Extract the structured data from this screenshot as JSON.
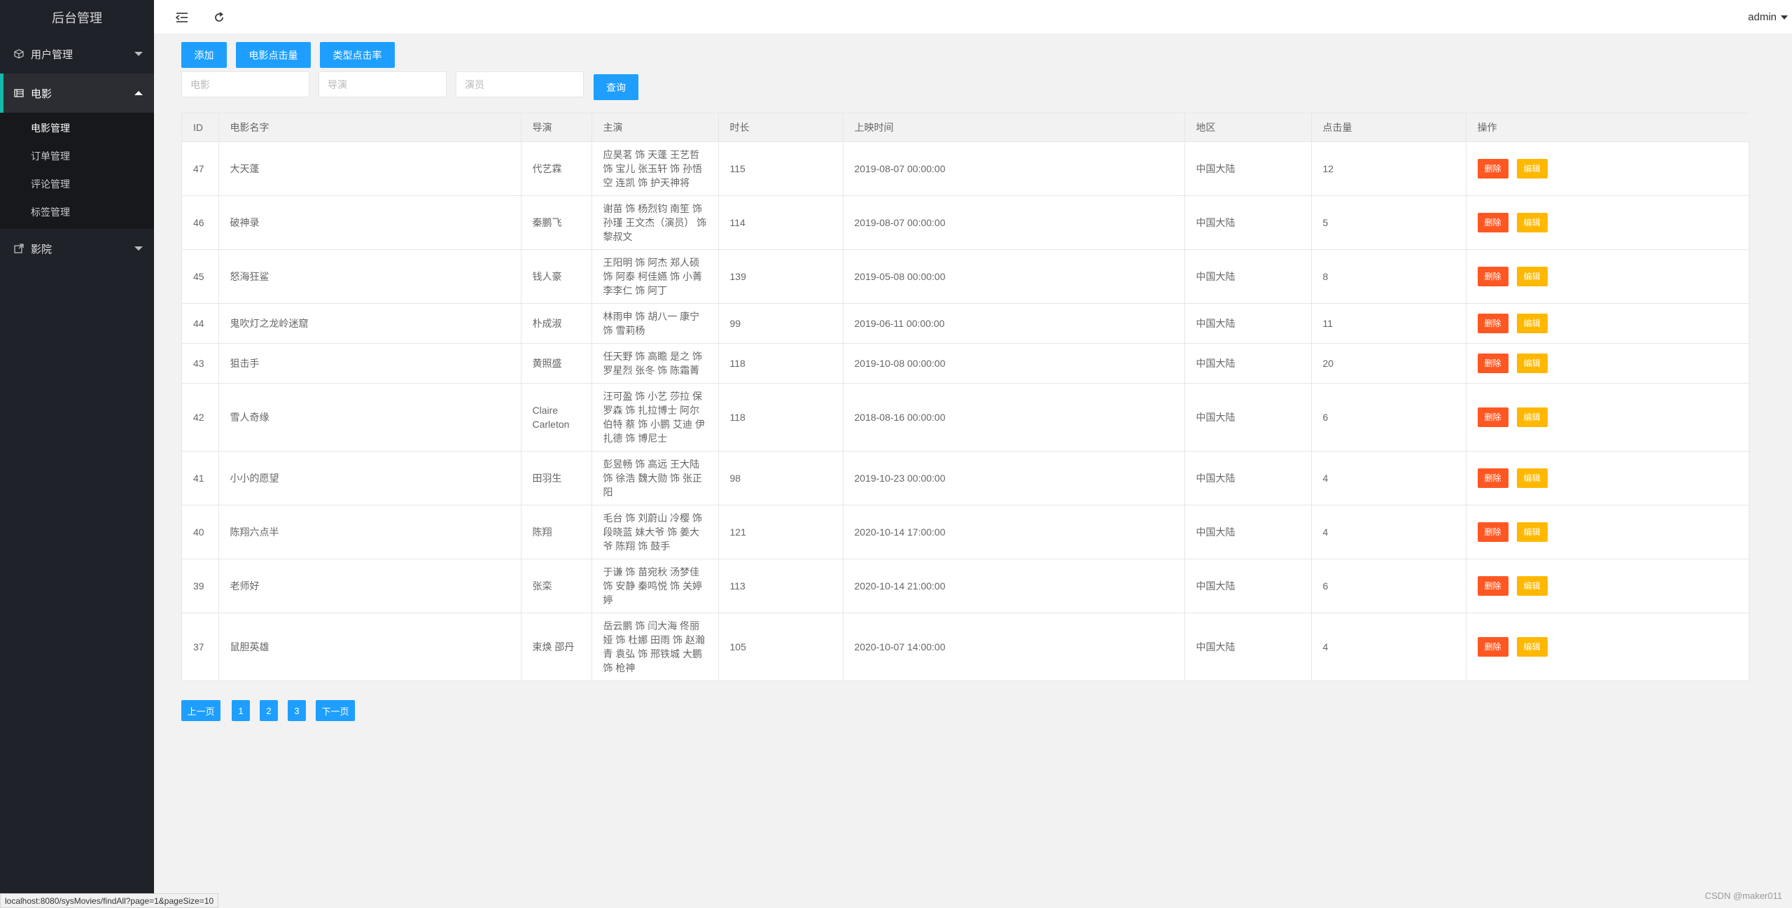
{
  "app": {
    "title": "后台管理"
  },
  "sidebar": {
    "items": [
      {
        "label": "用户管理",
        "icon": "user-cube-icon"
      },
      {
        "label": "电影",
        "icon": "film-icon",
        "expanded": true,
        "children": [
          "电影管理",
          "订单管理",
          "评论管理",
          "标签管理"
        ],
        "active_child": "电影管理"
      },
      {
        "label": "影院",
        "icon": "cinema-icon"
      }
    ]
  },
  "header": {
    "user": "admin"
  },
  "toolbar": {
    "add_label": "添加",
    "movie_clicks_label": "电影点击量",
    "type_click_rate_label": "类型点击率"
  },
  "search": {
    "movie_placeholder": "电影",
    "director_placeholder": "导演",
    "actor_placeholder": "演员",
    "query_label": "查询"
  },
  "table": {
    "columns": [
      "ID",
      "电影名字",
      "导演",
      "主演",
      "时长",
      "上映时间",
      "地区",
      "点击量",
      "操作"
    ],
    "delete_label": "删除",
    "edit_label": "编辑",
    "rows": [
      {
        "id": "47",
        "name": "大天蓬",
        "director": "代艺霖",
        "actors": "应昊茗 饰 天蓬 王艺哲 饰 宝儿 张玉轩 饰 孙悟空 连凯 饰 护天神将",
        "duration": "115",
        "release": "2019-08-07 00:00:00",
        "region": "中国大陆",
        "clicks": "12"
      },
      {
        "id": "46",
        "name": "破神录",
        "director": "秦鹏飞",
        "actors": "谢苗 饰 杨烈钧 南笙 饰 孙瑾 王文杰（演员） 饰 黎叔文",
        "duration": "114",
        "release": "2019-08-07 00:00:00",
        "region": "中国大陆",
        "clicks": "5"
      },
      {
        "id": "45",
        "name": "怒海狂鲨",
        "director": "钱人豪",
        "actors": "王阳明 饰 阿杰 郑人硕 饰 阿泰 柯佳嬿 饰 小菁 李李仁 饰 阿丁",
        "duration": "139",
        "release": "2019-05-08 00:00:00",
        "region": "中国大陆",
        "clicks": "8"
      },
      {
        "id": "44",
        "name": "鬼吹灯之龙岭迷窟",
        "director": "朴成淑",
        "actors": "林雨申 饰 胡八一 康宁 饰 雪莉杨",
        "duration": "99",
        "release": "2019-06-11 00:00:00",
        "region": "中国大陆",
        "clicks": "11"
      },
      {
        "id": "43",
        "name": "狙击手",
        "director": "黄照盛",
        "actors": "任天野 饰 高瞻 是之 饰 罗星烈 张冬 饰 陈霜菁",
        "duration": "118",
        "release": "2019-10-08 00:00:00",
        "region": "中国大陆",
        "clicks": "20"
      },
      {
        "id": "42",
        "name": "雪人奇缘",
        "director": "Claire Carleton",
        "actors": "汪可盈 饰 小艺 莎拉 保罗森 饰 扎拉博士 阿尔伯特 蔡 饰 小鹏 艾迪 伊扎德 饰 博尼士",
        "duration": "118",
        "release": "2018-08-16 00:00:00",
        "region": "中国大陆",
        "clicks": "6"
      },
      {
        "id": "41",
        "name": "小小的愿望",
        "director": "田羽生",
        "actors": "彭昱畅 饰 高远 王大陆 饰 徐浩 魏大勋 饰 张正阳",
        "duration": "98",
        "release": "2019-10-23 00:00:00",
        "region": "中国大陆",
        "clicks": "4"
      },
      {
        "id": "40",
        "name": "陈翔六点半",
        "director": "陈翔",
        "actors": "毛台 饰 刘蔚山 冷樱 饰 段晓蓝 妹大爷 饰 姜大爷 陈翔 饰 鼓手",
        "duration": "121",
        "release": "2020-10-14 17:00:00",
        "region": "中国大陆",
        "clicks": "4"
      },
      {
        "id": "39",
        "name": "老师好",
        "director": "张栾",
        "actors": "于谦 饰 苗宛秋 汤梦佳 饰 安静 秦鸣悦 饰 关婷婷",
        "duration": "113",
        "release": "2020-10-14 21:00:00",
        "region": "中国大陆",
        "clicks": "6"
      },
      {
        "id": "37",
        "name": "鼠胆英雄",
        "director": "束焕 邵丹",
        "actors": "岳云鹏 饰 闫大海 佟丽娅 饰 杜娜 田雨 饰 赵瀚青 袁弘 饰 邢铁城 大鹏 饰 枪神",
        "duration": "105",
        "release": "2020-10-07 14:00:00",
        "region": "中国大陆",
        "clicks": "4"
      }
    ]
  },
  "pagination": {
    "prev": "上一页",
    "pages": [
      "1",
      "2",
      "3"
    ],
    "next": "下一页"
  },
  "status_bar": {
    "url": "localhost:8080/sysMovies/findAll?page=1&pageSize=10"
  },
  "watermark": "CSDN @maker011",
  "colors": {
    "sidebar_bg": "#20222a",
    "primary": "#1e9fff",
    "danger": "#ff5722",
    "warn": "#ffb800",
    "accent": "#16baaa"
  }
}
